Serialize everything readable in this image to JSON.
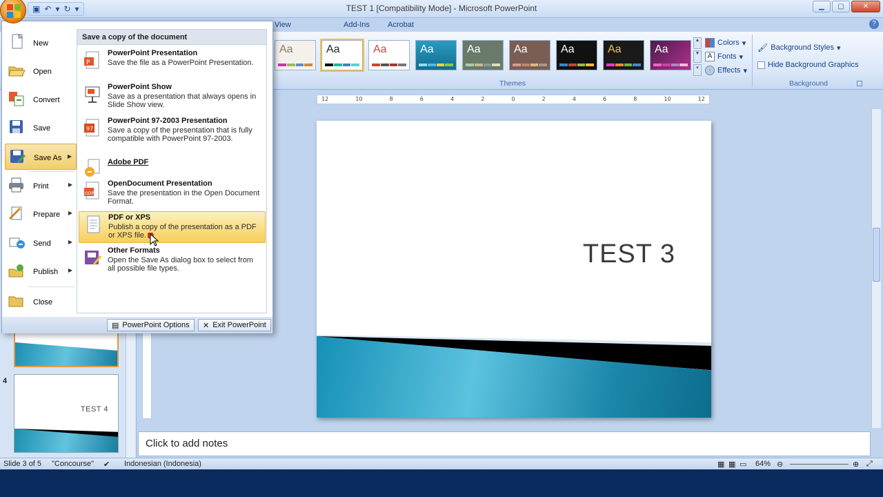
{
  "window": {
    "title": "TEST 1 [Compatibility Mode] - Microsoft PowerPoint",
    "controls": [
      "minimize",
      "maximize",
      "close"
    ]
  },
  "ribbon": {
    "tabs": [
      "View",
      "Add-Ins",
      "Acrobat"
    ],
    "themes_group_label": "Themes",
    "theme_sample": "Aa",
    "theme_options": {
      "colors": "Colors",
      "fonts": "Fonts",
      "effects": "Effects"
    },
    "background_group_label": "Background",
    "background_styles": "Background Styles",
    "hide_background_graphics": "Hide Background Graphics"
  },
  "office_menu": {
    "items": [
      {
        "label": "New",
        "icon": "new-document-icon",
        "has_submenu": false
      },
      {
        "label": "Open",
        "icon": "open-folder-icon",
        "has_submenu": false
      },
      {
        "label": "Convert",
        "icon": "convert-icon",
        "has_submenu": false
      },
      {
        "label": "Save",
        "icon": "save-disk-icon",
        "has_submenu": false
      },
      {
        "label": "Save As",
        "icon": "save-as-icon",
        "has_submenu": true
      },
      {
        "label": "Print",
        "icon": "printer-icon",
        "has_submenu": true
      },
      {
        "label": "Prepare",
        "icon": "prepare-icon",
        "has_submenu": true
      },
      {
        "label": "Send",
        "icon": "send-icon",
        "has_submenu": true
      },
      {
        "label": "Publish",
        "icon": "publish-icon",
        "has_submenu": true
      },
      {
        "label": "Close",
        "icon": "close-folder-icon",
        "has_submenu": false
      }
    ],
    "submenu": {
      "header": "Save a copy of the document",
      "items": [
        {
          "name": "PowerPoint Presentation",
          "desc": "Save the file as a PowerPoint Presentation."
        },
        {
          "name": "PowerPoint Show",
          "desc": "Save as a presentation that always opens in Slide Show view."
        },
        {
          "name": "PowerPoint 97-2003 Presentation",
          "desc": "Save a copy of the presentation that is fully compatible with PowerPoint 97-2003."
        },
        {
          "name": "Adobe PDF",
          "desc": ""
        },
        {
          "name": "OpenDocument Presentation",
          "desc": "Save the presentation in the Open Document Format."
        },
        {
          "name": "PDF or XPS",
          "desc": "Publish a copy of the presentation as a PDF or XPS file."
        },
        {
          "name": "Other Formats",
          "desc": "Open the Save As dialog box to select from all possible file types."
        }
      ]
    },
    "footer": {
      "options": "PowerPoint Options",
      "exit": "Exit PowerPoint"
    }
  },
  "slides_pane": {
    "thumb4_number": "4",
    "thumb4_title": "TEST 4"
  },
  "slide": {
    "title": "TEST 3",
    "notes_placeholder": "Click to add notes"
  },
  "ruler": [
    "12",
    "10",
    "8",
    "6",
    "4",
    "2",
    "0",
    "2",
    "4",
    "6",
    "8",
    "10",
    "12"
  ],
  "status": {
    "slide": "Slide 3 of 5",
    "theme": "\"Concourse\"",
    "language": "Indonesian (Indonesia)",
    "zoom": "64%"
  },
  "colors": {
    "accent": "#f6c243",
    "ribbon": "#dae7f8",
    "slide_wave": "#1690b6"
  }
}
